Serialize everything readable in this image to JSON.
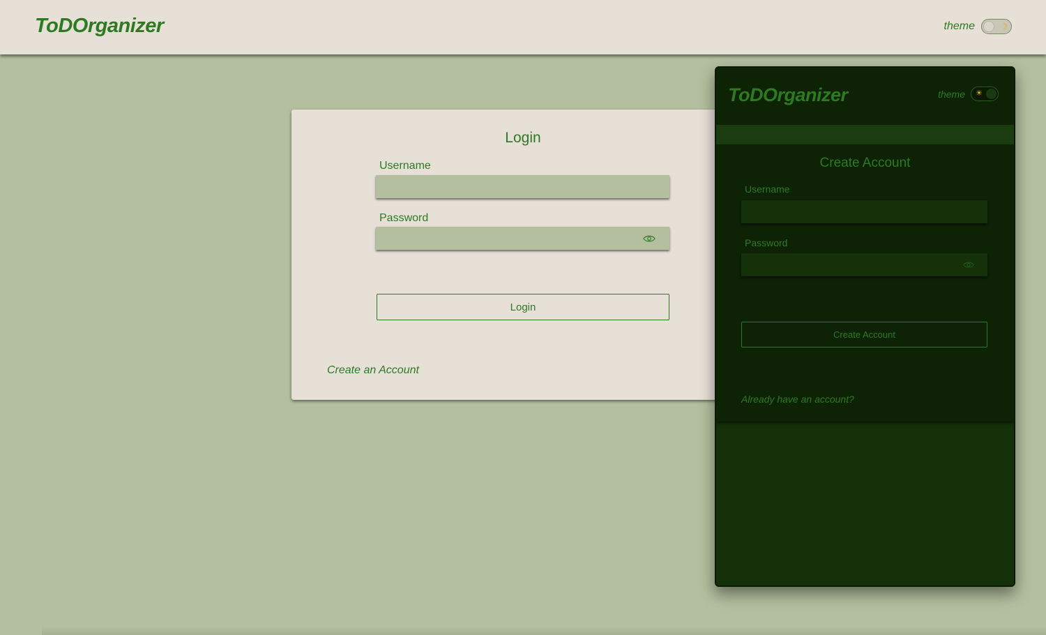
{
  "app": {
    "title": "ToDOrganizer"
  },
  "header": {
    "theme_label": "theme",
    "theme_mode": "light"
  },
  "login": {
    "title": "Login",
    "username_label": "Username",
    "username_value": "",
    "password_label": "Password",
    "password_value": "",
    "submit_label": "Login",
    "create_link": "Create an Account"
  },
  "preview": {
    "app_title": "ToDOrganizer",
    "theme_label": "theme",
    "theme_mode": "dark",
    "signup": {
      "title": "Create Account",
      "username_label": "Username",
      "username_value": "",
      "password_label": "Password",
      "password_value": "",
      "submit_label": "Create Account",
      "login_link": "Already have an account?"
    }
  },
  "colors": {
    "accent": "#2d7a22",
    "page_bg": "#b3bf9f",
    "surface_light": "#e6e0d7",
    "surface_dark": "#0e2206",
    "panel_dark": "#153109"
  },
  "icons": {
    "toggle_light": "moon-icon",
    "toggle_dark": "sun-icon",
    "password_reveal": "eye-icon"
  }
}
